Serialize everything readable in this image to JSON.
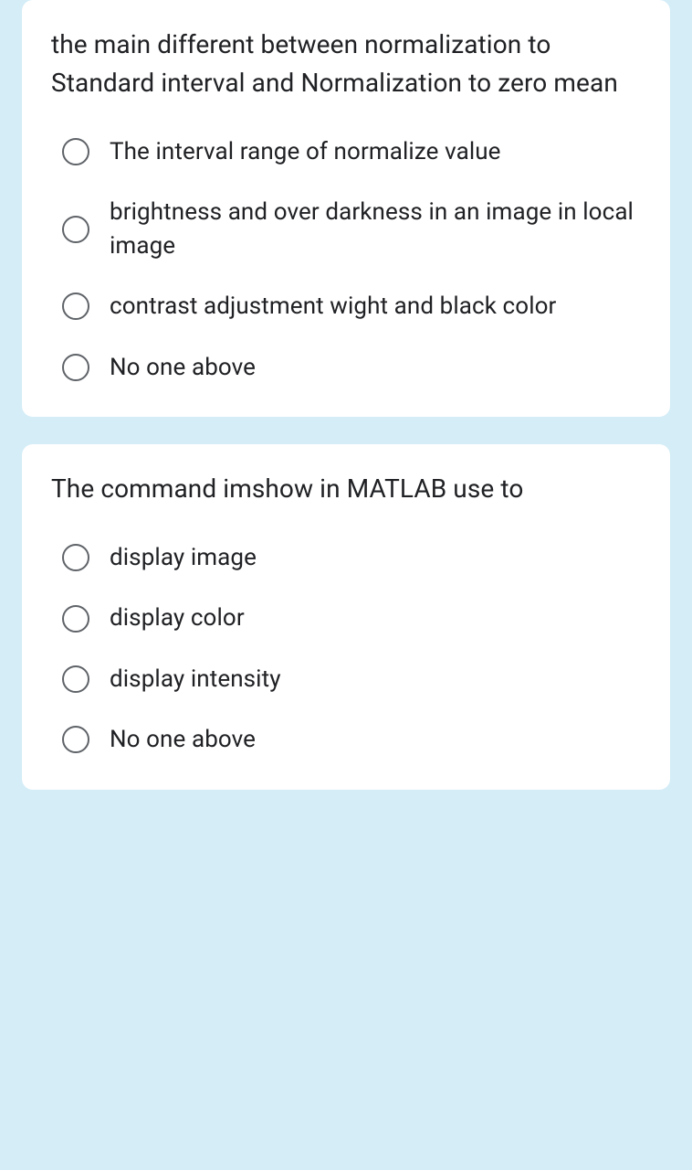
{
  "questions": [
    {
      "text": "the main different between normalization to Standard interval and Normalization to zero mean",
      "options": [
        "The interval range of normalize value",
        "brightness and over darkness in an image in local image",
        "contrast adjustment wight and black color",
        "No one above"
      ]
    },
    {
      "text": "The command imshow in MATLAB use to",
      "options": [
        "display image",
        "display color",
        "display intensity",
        "No one above"
      ]
    }
  ]
}
